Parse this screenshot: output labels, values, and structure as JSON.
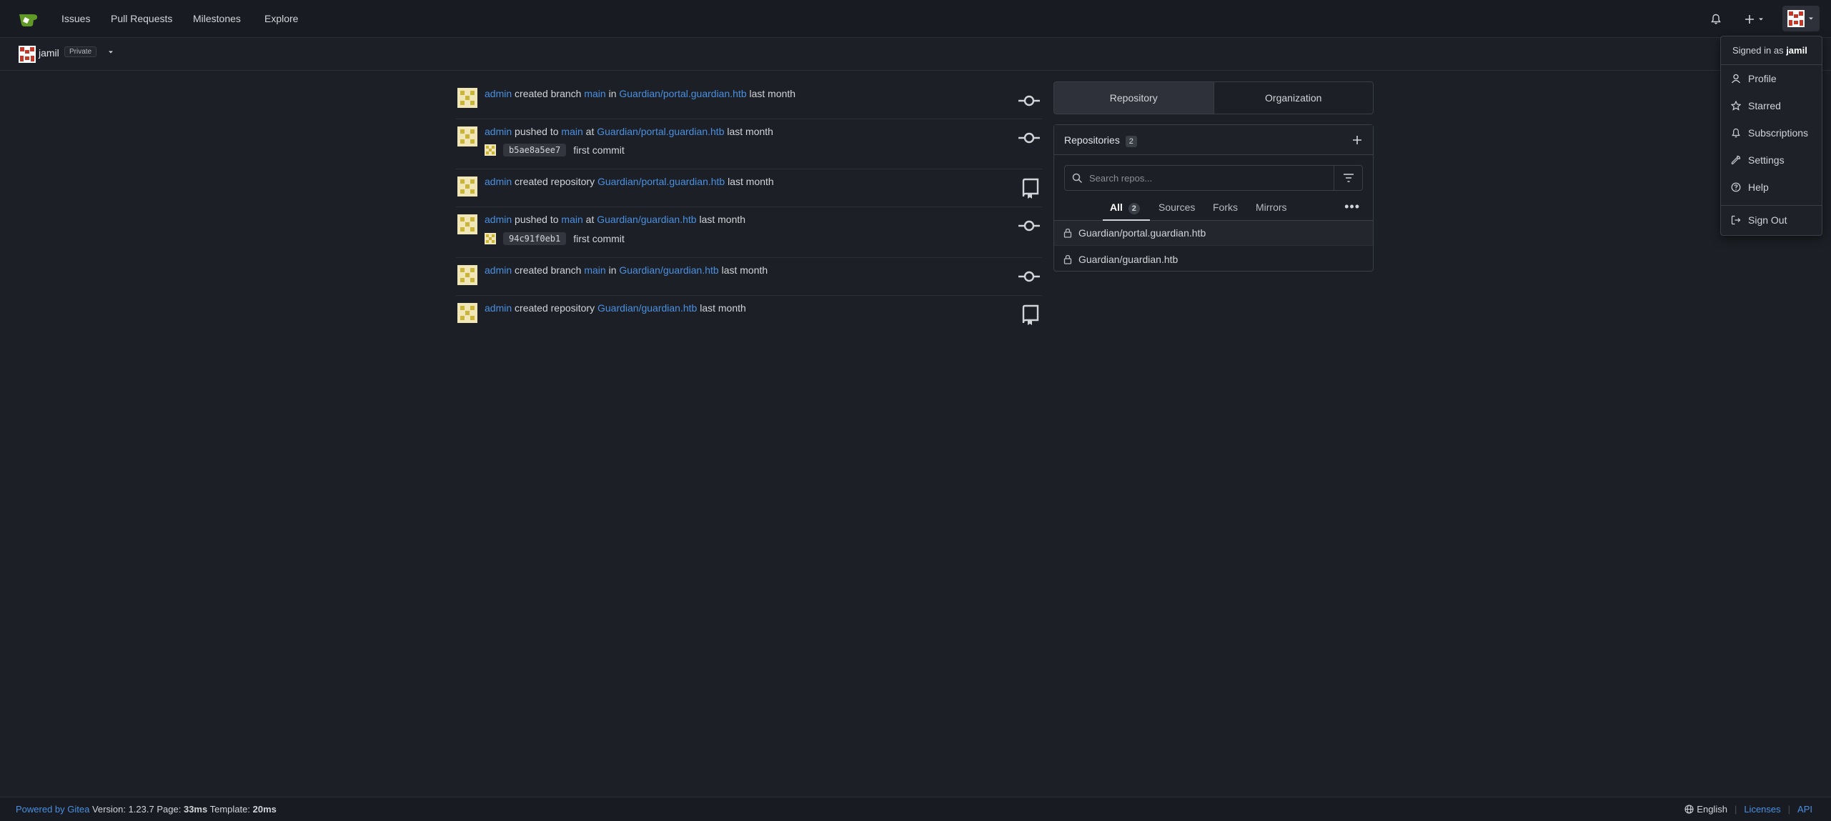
{
  "colors": {
    "link": "#4a90e2",
    "background": "#1c1f25",
    "navbar": "#181b21"
  },
  "nav": {
    "logo_icon": "gitea-logo-icon",
    "items": [
      "Issues",
      "Pull Requests",
      "Milestones",
      "Explore"
    ]
  },
  "context": {
    "name": "jamil",
    "badge": "Private"
  },
  "feed": [
    {
      "actor": "admin",
      "verb": "created branch",
      "ref": "main",
      "prep": "in",
      "repo": "Guardian/portal.guardian.htb",
      "time": "last month",
      "icon": "commit-icon"
    },
    {
      "actor": "admin",
      "verb": "pushed to",
      "ref": "main",
      "prep": "at",
      "repo": "Guardian/portal.guardian.htb",
      "time": "last month",
      "icon": "commit-icon",
      "commit": {
        "sha": "b5ae8a5ee7",
        "message": "first commit"
      }
    },
    {
      "actor": "admin",
      "verb": "created repository",
      "ref": "",
      "prep": "",
      "repo": "Guardian/portal.guardian.htb",
      "time": "last month",
      "icon": "repo-icon"
    },
    {
      "actor": "admin",
      "verb": "pushed to",
      "ref": "main",
      "prep": "at",
      "repo": "Guardian/guardian.htb",
      "time": "last month",
      "icon": "commit-icon",
      "commit": {
        "sha": "94c91f0eb1",
        "message": "first commit"
      }
    },
    {
      "actor": "admin",
      "verb": "created branch",
      "ref": "main",
      "prep": "in",
      "repo": "Guardian/guardian.htb",
      "time": "last month",
      "icon": "commit-icon"
    },
    {
      "actor": "admin",
      "verb": "created repository",
      "ref": "",
      "prep": "",
      "repo": "Guardian/guardian.htb",
      "time": "last month",
      "icon": "repo-icon"
    }
  ],
  "panel": {
    "tabs": [
      "Repository",
      "Organization"
    ],
    "repos_title": "Repositories",
    "repos_count": "2",
    "search_placeholder": "Search repos...",
    "subtabs": {
      "all": "All",
      "all_count": "2",
      "sources": "Sources",
      "forks": "Forks",
      "mirrors": "Mirrors"
    },
    "repos": [
      "Guardian/portal.guardian.htb",
      "Guardian/guardian.htb"
    ]
  },
  "user_menu": {
    "signed_in_prefix": "Signed in as",
    "username": "jamil",
    "items": [
      "Profile",
      "Starred",
      "Subscriptions",
      "Settings",
      "Help"
    ],
    "sign_out": "Sign Out"
  },
  "footer": {
    "powered": "Powered by Gitea",
    "version_label": "Version:",
    "version": "1.23.7",
    "page_label": "Page:",
    "page_time": "33ms",
    "template_label": "Template:",
    "template_time": "20ms",
    "language": "English",
    "licenses": "Licenses",
    "api": "API"
  }
}
